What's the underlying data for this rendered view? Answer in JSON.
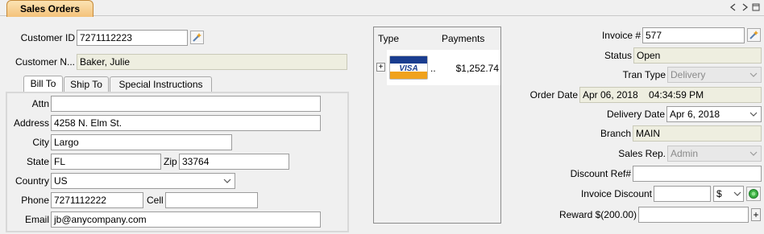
{
  "header": {
    "tab_label": "Sales Orders"
  },
  "customer": {
    "id_label": "Customer ID",
    "id_value": "7271112223",
    "name_label": "Customer N...",
    "name_value": "Baker, Julie"
  },
  "tabs": [
    {
      "label": "Bill To",
      "active": true
    },
    {
      "label": "Ship To",
      "active": false
    },
    {
      "label": "Special Instructions",
      "active": false
    }
  ],
  "bill_to": {
    "attn_label": "Attn",
    "attn_value": "",
    "address_label": "Address",
    "address_value": "4258 N. Elm St.",
    "city_label": "City",
    "city_value": "Largo",
    "state_label": "State",
    "state_value": "FL",
    "zip_label": "Zip",
    "zip_value": "33764",
    "country_label": "Country",
    "country_value": "US",
    "phone_label": "Phone",
    "phone_value": "7271112222",
    "cell_label": "Cell",
    "cell_value": "",
    "email_label": "Email",
    "email_value": "jb@anycompany.com"
  },
  "payments": {
    "col_type": "Type",
    "col_payments": "Payments",
    "expand_glyph": "+",
    "rows": [
      {
        "card_brand": "VISA",
        "type_text": "..",
        "amount": "$1,252.74"
      }
    ]
  },
  "invoice": {
    "invoice_no_label": "Invoice #",
    "invoice_no_value": "577",
    "status_label": "Status",
    "status_value": "Open",
    "tran_type_label": "Tran Type",
    "tran_type_value": "Delivery",
    "order_date_label": "Order Date",
    "order_date_value": "Apr 06, 2018    04:34:59 PM",
    "delivery_date_label": "Delivery Date",
    "delivery_date_value": "Apr 6, 2018",
    "branch_label": "Branch",
    "branch_value": "MAIN",
    "sales_rep_label": "Sales Rep.",
    "sales_rep_value": "Admin",
    "discount_ref_label": "Discount Ref#",
    "discount_ref_value": "",
    "invoice_discount_label": "Invoice Discount",
    "invoice_discount_value": "",
    "discount_unit": "$",
    "reward_label": "Reward $(200.00)",
    "reward_value": "",
    "reward_button": "+"
  },
  "icons": {
    "lookup": "lookup-wand-icon",
    "dropdown": "chevron-down-icon",
    "apply": "green-circle-icon"
  },
  "colors": {
    "tab_accent": "#f4c27a",
    "readonly_bg": "#eeeee0",
    "disabled_bg": "#e8e8e8"
  }
}
